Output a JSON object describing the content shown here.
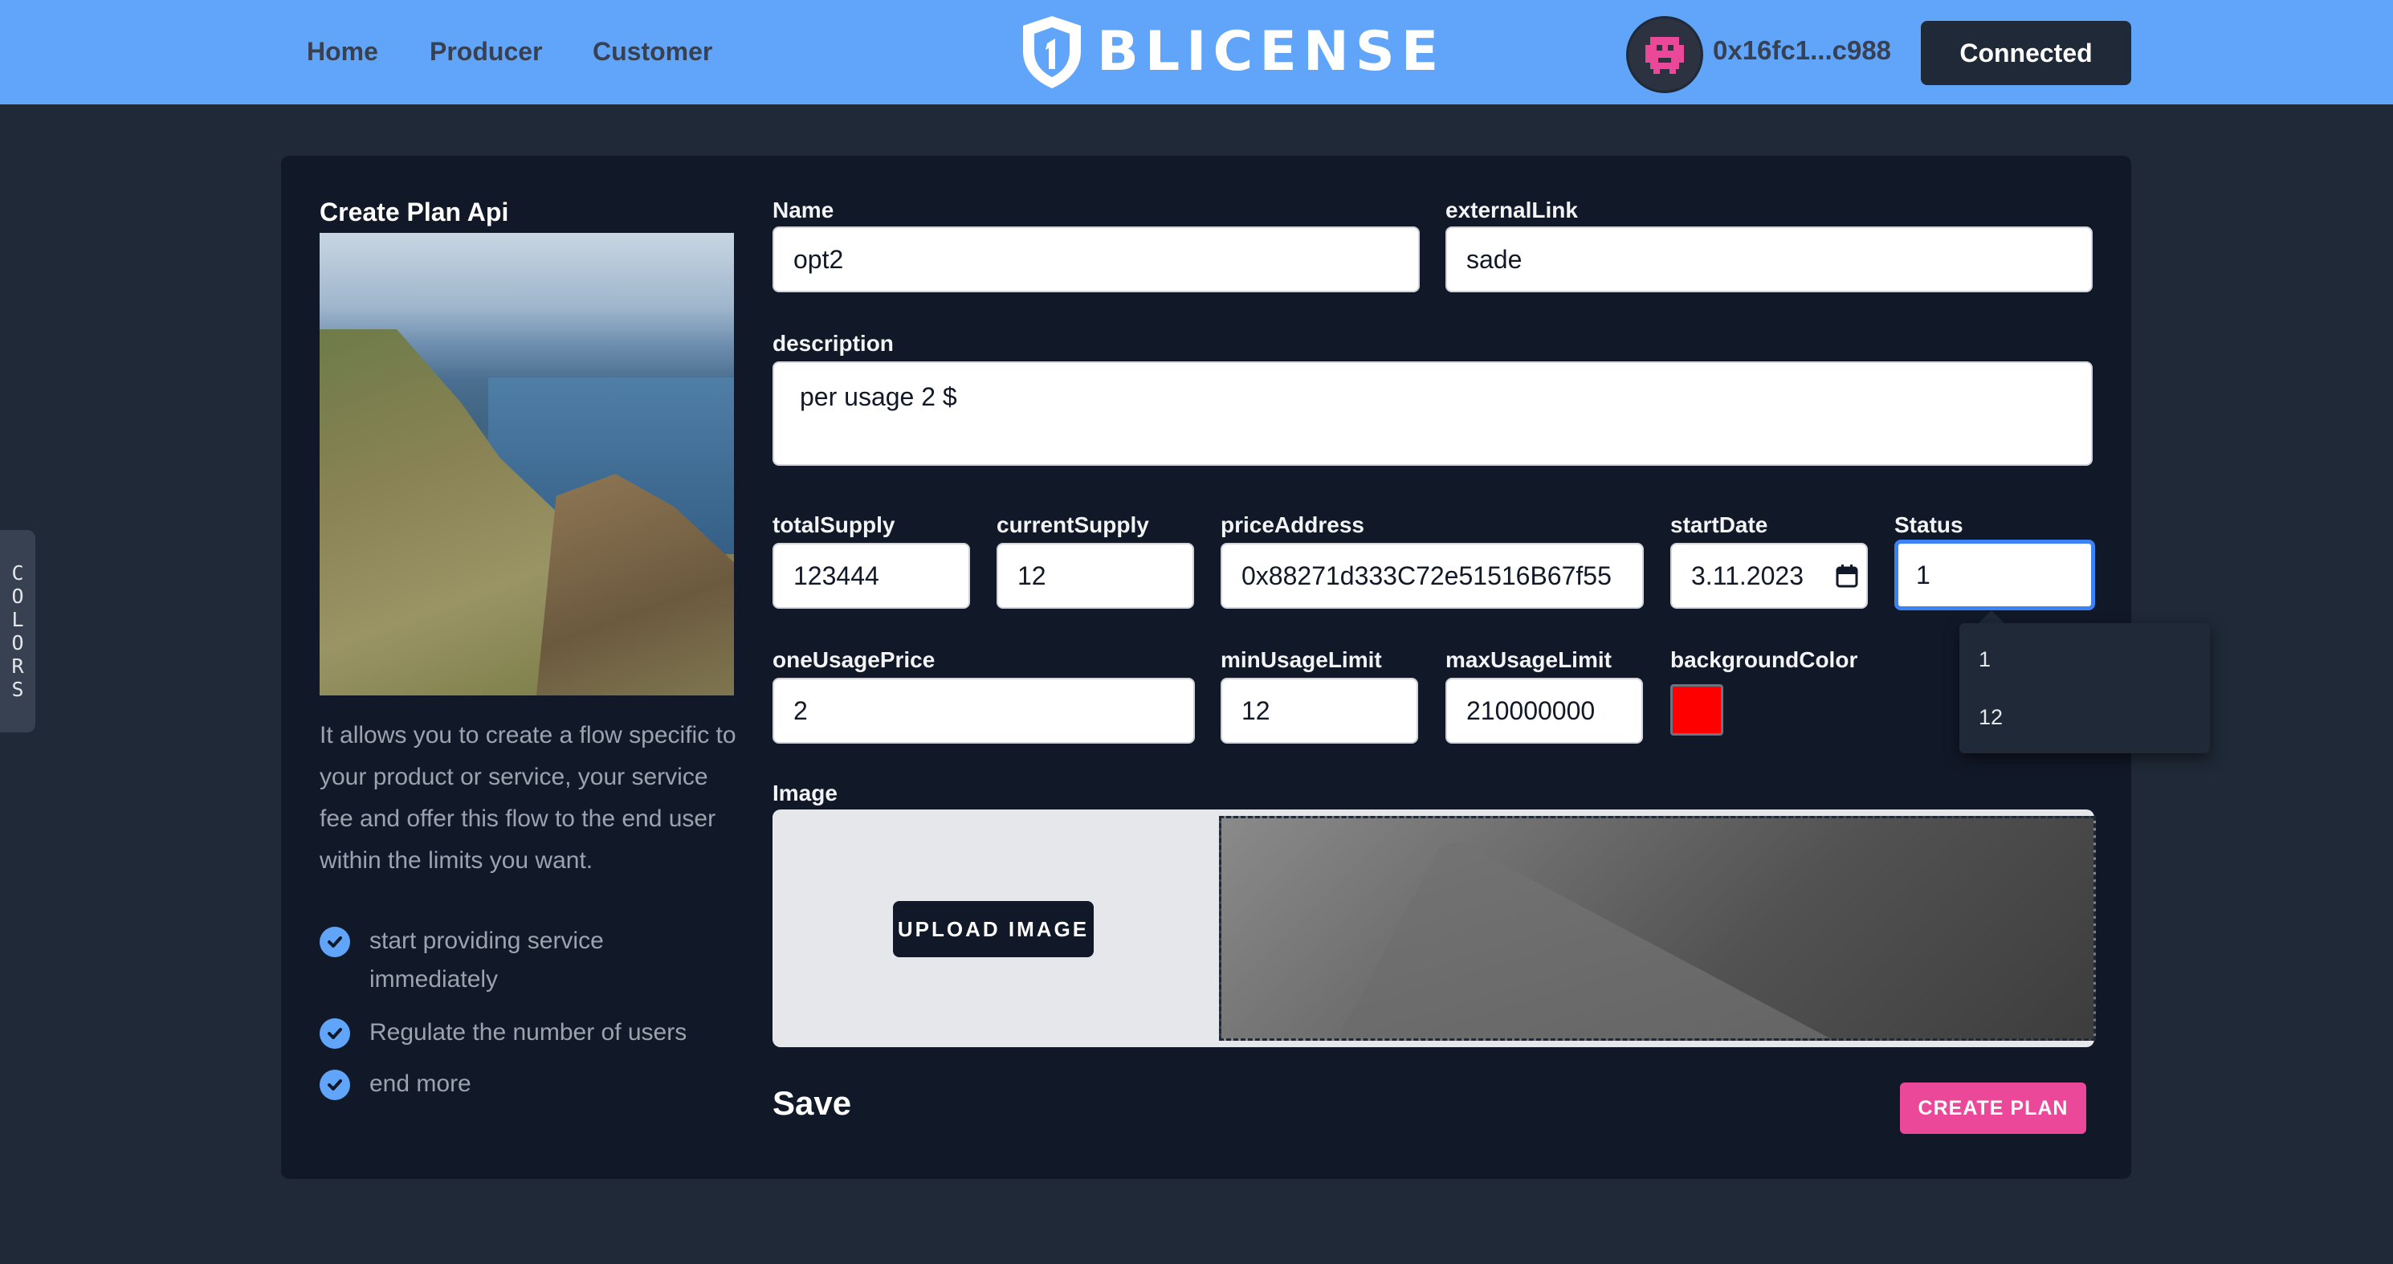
{
  "header": {
    "nav": [
      "Home",
      "Producer",
      "Customer"
    ],
    "brand": "BLICENSE",
    "wallet_address": "0x16fc1...c988",
    "connected_label": "Connected"
  },
  "side_tab": {
    "letters": [
      "C",
      "O",
      "L",
      "O",
      "R",
      "S"
    ]
  },
  "left_panel": {
    "title": "Create Plan Api",
    "description": "It allows you to create a flow specific to your product or service, your service fee and offer this flow to the end user within the limits you want.",
    "features": [
      "start providing service immediately",
      "Regulate the number of users",
      "end more"
    ]
  },
  "form": {
    "name": {
      "label": "Name",
      "value": "opt2"
    },
    "external_link": {
      "label": "externalLink",
      "value": "sade"
    },
    "description": {
      "label": "description",
      "value": "per usage 2 $"
    },
    "total_supply": {
      "label": "totalSupply",
      "value": "123444"
    },
    "current_supply": {
      "label": "currentSupply",
      "value": "12"
    },
    "price_address": {
      "label": "priceAddress",
      "value": "0x88271d333C72e51516B67f55"
    },
    "start_date": {
      "label": "startDate",
      "value": "3.11.2023"
    },
    "status": {
      "label": "Status",
      "value": "1",
      "options": [
        "1",
        "12"
      ]
    },
    "one_usage_price": {
      "label": "oneUsagePrice",
      "value": "2"
    },
    "min_usage_limit": {
      "label": "minUsageLimit",
      "value": "12"
    },
    "max_usage_limit": {
      "label": "maxUsageLimit",
      "value": "210000000"
    },
    "background_color": {
      "label": "backgroundColor",
      "value": "#ff0000"
    },
    "image": {
      "label": "Image",
      "upload_label": "UPLOAD IMAGE"
    },
    "save_heading": "Save",
    "create_plan_label": "CREATE PLAN"
  },
  "colors": {
    "header_bg": "#60a5fa",
    "page_bg": "#1f2937",
    "card_bg": "#111827",
    "accent_pink": "#ec4899",
    "check_blue": "#60a5fa"
  },
  "icons": [
    "shield-logo-icon",
    "calendar-icon",
    "check-circle-icon"
  ]
}
